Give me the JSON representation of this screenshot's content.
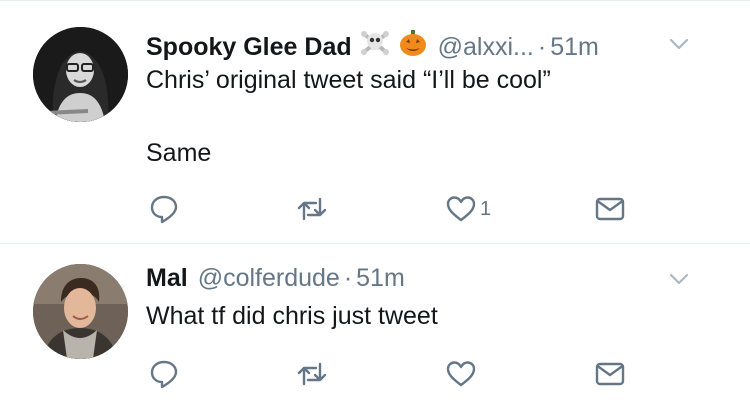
{
  "tweets": [
    {
      "display_name": "Spooky Glee Dad",
      "emojis": [
        "skull-crossbones",
        "jack-o-lantern"
      ],
      "handle": "@alxxi...",
      "separator": "·",
      "time": "51m",
      "text_lines": [
        "Chris’ original tweet said “I’ll be cool”",
        "Same"
      ],
      "like_count": "1"
    },
    {
      "display_name": "Mal",
      "handle": "@colferdude",
      "separator": "·",
      "time": "51m",
      "text_lines": [
        "What tf did chris just tweet"
      ],
      "like_count": ""
    }
  ],
  "colors": {
    "text": "#14171a",
    "secondary": "#657786",
    "icon": "#657786",
    "divider": "#e6ecf0"
  },
  "icons": [
    "reply-icon",
    "retweet-icon",
    "like-icon",
    "direct-message-icon",
    "chevron-down-icon"
  ]
}
